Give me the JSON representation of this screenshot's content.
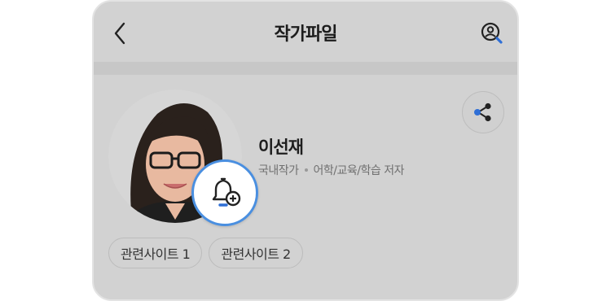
{
  "header": {
    "title": "작가파일",
    "back_icon": "chevron-left-icon",
    "profile_icon": "user-search-icon"
  },
  "author": {
    "name": "이선재",
    "category": "국내작가",
    "role": "어학/교육/학습 저자",
    "photo_description": "author-photo"
  },
  "actions": {
    "share_icon": "share-icon",
    "alert_icon": "bell-plus-icon"
  },
  "related_sites": [
    {
      "label": "관련사이트 1"
    },
    {
      "label": "관련사이트 2"
    }
  ],
  "colors": {
    "accent": "#4a8fe0",
    "background": "#d2d2d2",
    "divider": "#c7c7c7"
  }
}
